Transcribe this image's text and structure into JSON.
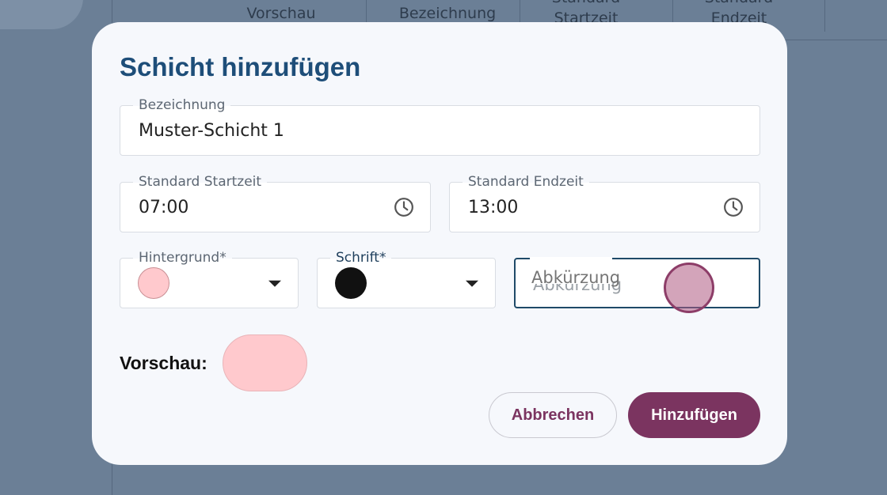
{
  "background": {
    "columns": [
      "Vorschau",
      "Bezeichnung",
      "Standard Startzeit",
      "Standard Endzeit"
    ]
  },
  "dialog": {
    "title": "Schicht hinzufügen",
    "name_field": {
      "label": "Bezeichnung",
      "value": "Muster-Schicht 1"
    },
    "start_field": {
      "label": "Standard Startzeit",
      "value": "07:00",
      "icon": "clock-icon"
    },
    "end_field": {
      "label": "Standard Endzeit",
      "value": "13:00",
      "icon": "clock-icon"
    },
    "background_field": {
      "label": "Hintergrund*",
      "color": "#ffc9cd"
    },
    "font_field": {
      "label": "Schrift*",
      "color": "#111111"
    },
    "abbr_field": {
      "placeholder": "Abkürzung",
      "value": ""
    },
    "preview_label": "Vorschau:",
    "preview_color": "#ffc9cd",
    "cancel_label": "Abbrechen",
    "submit_label": "Hinzufügen",
    "accent_color": "#7b3460",
    "title_color": "#1e4e79"
  }
}
